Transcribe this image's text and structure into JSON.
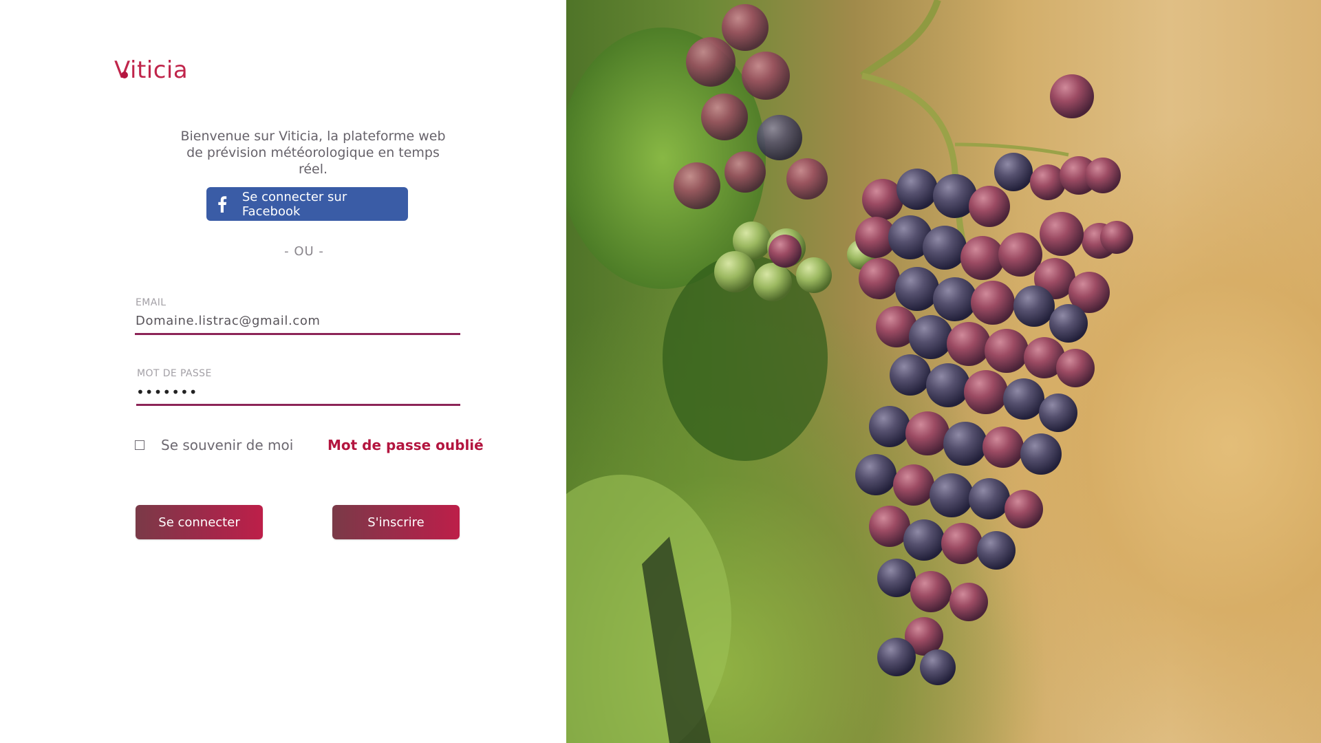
{
  "brand": {
    "logo_text": "Viticia",
    "color": "#c0254b"
  },
  "welcome_text": "Bienvenue sur Viticia, la plateforme web de prévision météorologique en temps réel.",
  "facebook": {
    "label": "Se connecter sur Facebook",
    "icon": "facebook-icon",
    "color": "#3a5ca6"
  },
  "separator": "- OU -",
  "email": {
    "label": "EMAIL",
    "value": "Domaine.listrac@gmail.com"
  },
  "password": {
    "label": "MOT DE PASSE",
    "value": "1234567"
  },
  "remember_me": {
    "label": "Se souvenir de moi",
    "checked": false
  },
  "forgot_password": "Mot de passe oublié",
  "buttons": {
    "login": "Se connecter",
    "signup": "S'inscrire"
  },
  "accent_color": "#b3153f",
  "hero_image": "grapes-vineyard-photo"
}
